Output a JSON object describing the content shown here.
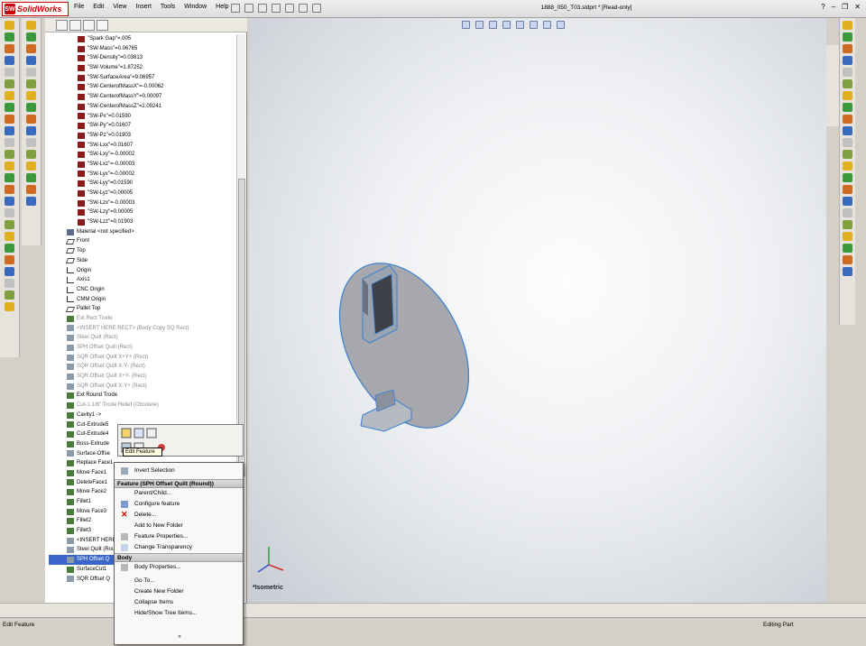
{
  "app": {
    "name": "SolidWorks",
    "doc_title": "1888_050_T03.sldprt * [Read-only]"
  },
  "menu": [
    "File",
    "Edit",
    "View",
    "Insert",
    "Tools",
    "Window",
    "Help"
  ],
  "tree": [
    {
      "label": "\"Spark Gap\"=.005",
      "kind": "eq"
    },
    {
      "label": "\"SW-Mass\"=0.06765",
      "kind": "eq"
    },
    {
      "label": "\"SW-Density\"=0.03613",
      "kind": "eq"
    },
    {
      "label": "\"SW-Volume\"=1.87252",
      "kind": "eq"
    },
    {
      "label": "\"SW-SurfaceArea\"=9.06957",
      "kind": "eq"
    },
    {
      "label": "\"SW-CenterofMassX\"=-0.00062",
      "kind": "eq"
    },
    {
      "label": "\"SW-CenterofMassY\"=0.00097",
      "kind": "eq"
    },
    {
      "label": "\"SW-CenterofMassZ\"=2.09241",
      "kind": "eq"
    },
    {
      "label": "\"SW-Px\"=0.01590",
      "kind": "eq"
    },
    {
      "label": "\"SW-Py\"=0.01607",
      "kind": "eq"
    },
    {
      "label": "\"SW-Pz\"=0.01903",
      "kind": "eq"
    },
    {
      "label": "\"SW-Lxx\"=0.01607",
      "kind": "eq"
    },
    {
      "label": "\"SW-Lxy\"=-0.00002",
      "kind": "eq"
    },
    {
      "label": "\"SW-Lxz\"=-0.00003",
      "kind": "eq"
    },
    {
      "label": "\"SW-Lyx\"=-0.00002",
      "kind": "eq"
    },
    {
      "label": "\"SW-Lyy\"=0.01590",
      "kind": "eq"
    },
    {
      "label": "\"SW-Lyz\"=0.00005",
      "kind": "eq"
    },
    {
      "label": "\"SW-Lzx\"=-0.00003",
      "kind": "eq"
    },
    {
      "label": "\"SW-Lzy\"=0.00005",
      "kind": "eq"
    },
    {
      "label": "\"SW-Lzz\"=0.01903",
      "kind": "eq"
    },
    {
      "label": "Material <not specified>",
      "kind": "mat",
      "top": true
    },
    {
      "label": "Front",
      "kind": "plane",
      "top": true
    },
    {
      "label": "Top",
      "kind": "plane",
      "top": true
    },
    {
      "label": "Side",
      "kind": "plane",
      "top": true
    },
    {
      "label": "Origin",
      "kind": "origin",
      "top": true
    },
    {
      "label": "Axis1",
      "kind": "axis",
      "top": true
    },
    {
      "label": "CNC Origin",
      "kind": "origin",
      "top": true
    },
    {
      "label": "CMM Origin",
      "kind": "origin",
      "top": true
    },
    {
      "label": "Pallet Top",
      "kind": "plane",
      "top": true
    },
    {
      "label": "Ext Rect Trode",
      "kind": "feat",
      "top": true,
      "grey": true
    },
    {
      "label": "<INSERT HERE RECT> (Body Copy SQ Rect)",
      "kind": "surf",
      "top": true,
      "grey": true
    },
    {
      "label": "Steel Quilt (Rect)",
      "kind": "surf",
      "top": true,
      "grey": true
    },
    {
      "label": "SPH Offset Quilt (Rect)",
      "kind": "surf",
      "top": true,
      "grey": true
    },
    {
      "label": "SQR Offset Quilt X+Y+ (Rect)",
      "kind": "surf",
      "top": true,
      "grey": true
    },
    {
      "label": "SQR Offset Quilt X-Y- (Rect)",
      "kind": "surf",
      "top": true,
      "grey": true
    },
    {
      "label": "SQR Offset Quilt X+Y- (Rect)",
      "kind": "surf",
      "top": true,
      "grey": true
    },
    {
      "label": "SQR Offset Quilt X-Y+ (Rect)",
      "kind": "surf",
      "top": true,
      "grey": true
    },
    {
      "label": "Ext Round Trode",
      "kind": "feat",
      "top": true
    },
    {
      "label": "Cut-1-1/8\" Trode Relief (Obsolete)",
      "kind": "feat",
      "top": true,
      "grey": true
    },
    {
      "label": "Cavity1 ->",
      "kind": "feat",
      "top": true
    },
    {
      "label": "Cut-Extrude5",
      "kind": "feat",
      "top": true
    },
    {
      "label": "Cut-Extrude4",
      "kind": "feat",
      "top": true
    },
    {
      "label": "Boss-Extrude",
      "kind": "feat",
      "top": true
    },
    {
      "label": "Surface-Offse",
      "kind": "surf",
      "top": true
    },
    {
      "label": "Replace Face1",
      "kind": "feat",
      "top": true
    },
    {
      "label": "Move Face1",
      "kind": "feat",
      "top": true
    },
    {
      "label": "DeleteFace1",
      "kind": "feat",
      "top": true
    },
    {
      "label": "Move Face2",
      "kind": "feat",
      "top": true
    },
    {
      "label": "Fillet1",
      "kind": "feat",
      "top": true
    },
    {
      "label": "Move Face3",
      "kind": "feat",
      "top": true
    },
    {
      "label": "Fillet2",
      "kind": "feat",
      "top": true
    },
    {
      "label": "Fillet3",
      "kind": "feat",
      "top": true
    },
    {
      "label": "<INSERT HERE",
      "kind": "surf",
      "top": true
    },
    {
      "label": "Steel Quilt (Rou",
      "kind": "surf",
      "top": true
    },
    {
      "label": "SPH Offset Q",
      "kind": "surf",
      "top": true,
      "selected": true
    },
    {
      "label": "SurfaceCut1",
      "kind": "feat",
      "top": true
    },
    {
      "label": "SQR Offset Q",
      "kind": "surf",
      "top": true
    }
  ],
  "context_toolbar": {
    "tooltip": "Edit Feature"
  },
  "context_menu": {
    "invert": "Invert Selection",
    "feature_header": "Feature (SPH Offset Quilt (Round))",
    "feature_items": [
      "Parent/Child...",
      "Configure feature",
      "Delete...",
      "Add to New Folder",
      "Feature Properties...",
      "Change Transparency"
    ],
    "body_header": "Body",
    "body_items": [
      "Body Properties..."
    ],
    "misc_items": [
      "Go To...",
      "Create New Folder",
      "Collapse Items",
      "Hide/Show Tree Items..."
    ],
    "more": "»"
  },
  "viewport": {
    "view_label": "*Isometric"
  },
  "status": {
    "left": "Edit Feature",
    "right": "Editing Part"
  },
  "colors": {
    "accent": "#3a66c9",
    "brand": "#cc0000",
    "model": "#a6a8ad",
    "edge": "#3c7fd0"
  }
}
